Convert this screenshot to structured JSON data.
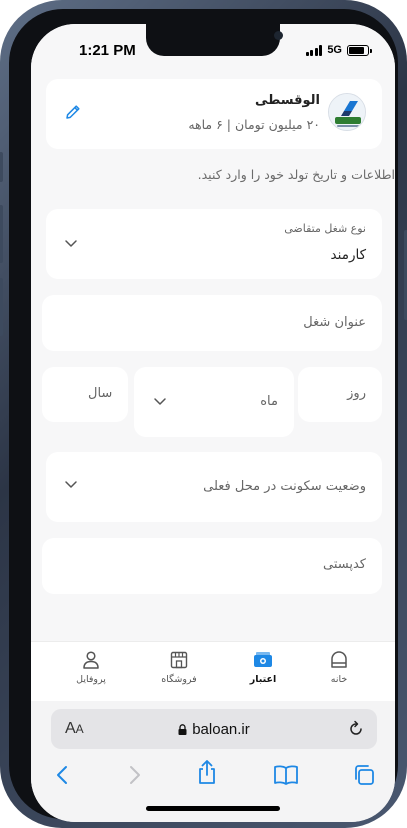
{
  "status_bar": {
    "time": "1:21 PM",
    "network": "5G",
    "battery_level": 0.85
  },
  "loan_card": {
    "title": "الوقسطی",
    "subtitle": "۲۰ میلیون تومان | ۶ ماهه",
    "logo_text": "الوقسطی",
    "edit_icon": "pencil-icon"
  },
  "instructions": "اطلاعات و تاریخ تولد خود را وارد کنید.",
  "form": {
    "job_type": {
      "label": "نوع شغل متقاضی",
      "value": "کارمند"
    },
    "job_title": {
      "placeholder": "عنوان شغل"
    },
    "birth_date": {
      "day_placeholder": "روز",
      "month_placeholder": "ماه",
      "year_placeholder": "سال"
    },
    "residence_status": {
      "placeholder": "وضعیت سکونت در محل فعلی"
    },
    "postal_code": {
      "placeholder": "کدپستی"
    }
  },
  "tabbar": {
    "items": [
      {
        "label": "خانه",
        "icon": "home-icon",
        "active": false
      },
      {
        "label": "اعتبار",
        "icon": "wallet-icon",
        "active": true
      },
      {
        "label": "فروشگاه",
        "icon": "store-icon",
        "active": false
      },
      {
        "label": "پروفایل",
        "icon": "profile-icon",
        "active": false
      }
    ]
  },
  "browser": {
    "text_size_label_big": "A",
    "text_size_label_small": "A",
    "url": "baloan.ir"
  },
  "colors": {
    "accent": "#1e88e5",
    "background": "#f7f7f8",
    "card": "#ffffff"
  }
}
